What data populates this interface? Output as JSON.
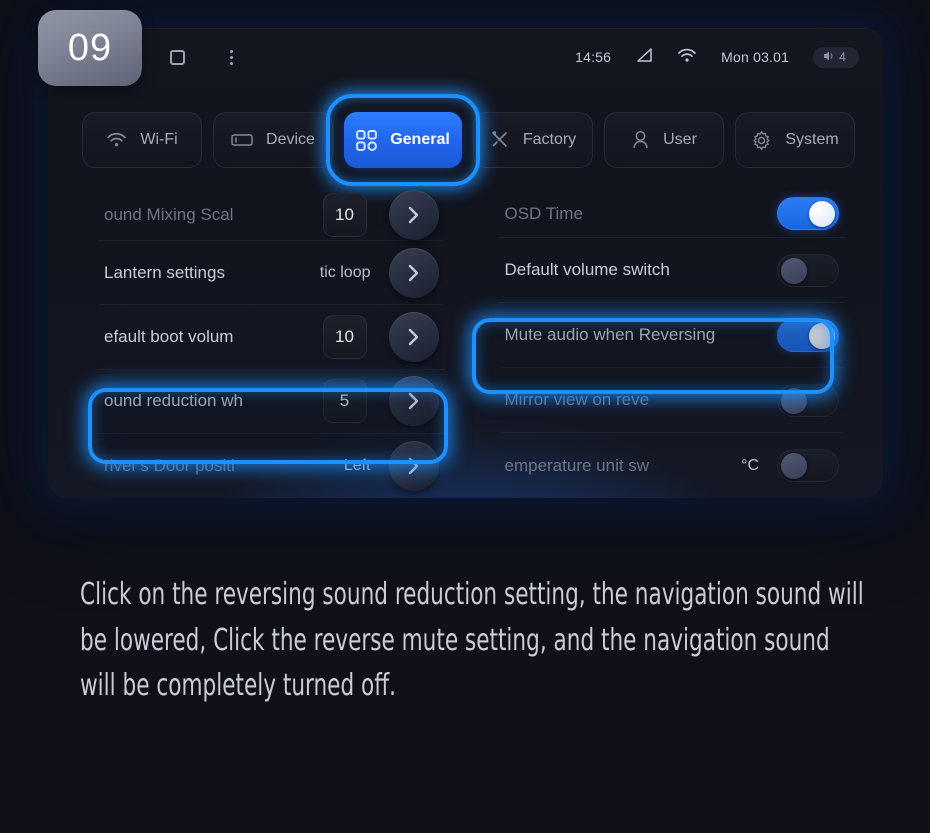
{
  "badge": {
    "number": "09"
  },
  "statusbar": {
    "nav": [
      {
        "name": "home-circle",
        "icon": "circle-icon"
      },
      {
        "name": "recents-square",
        "icon": "square-icon"
      },
      {
        "name": "overflow-menu",
        "icon": "three-dots-icon"
      }
    ],
    "time": "14:56",
    "signal_icon": "signal-triangle-icon",
    "wifi_icon": "wifi-icon",
    "date": "Mon 03.01",
    "volume_icon": "volume-icon",
    "volume_level": "4"
  },
  "tabs": [
    {
      "label": "Wi-Fi",
      "icon": "wifi-icon",
      "active": false
    },
    {
      "label": "Device",
      "icon": "device-icon",
      "active": false
    },
    {
      "label": "General",
      "icon": "grid-icon",
      "active": true
    },
    {
      "label": "Factory",
      "icon": "tools-icon",
      "active": false
    },
    {
      "label": "User",
      "icon": "person-icon",
      "active": false
    },
    {
      "label": "System",
      "icon": "gear-icon",
      "active": false
    }
  ],
  "settings": {
    "left_column": [
      {
        "label": "ound Mixing Scal",
        "value": "10",
        "control": "chevron",
        "clipped": true,
        "highlight": false
      },
      {
        "label": "Lantern settings",
        "value": "tic loop",
        "control": "chevron",
        "clipped": false,
        "highlight": false
      },
      {
        "label": "efault boot volum",
        "value": "10",
        "control": "chevron",
        "clipped": false,
        "highlight": false
      },
      {
        "label": "ound reduction wh",
        "value": "5",
        "control": "chevron",
        "clipped": false,
        "highlight": true
      },
      {
        "label": "river's Door positi",
        "value": "Left",
        "control": "chevron",
        "clipped": false,
        "highlight": false
      }
    ],
    "right_column": [
      {
        "label": "OSD Time",
        "value": "",
        "control": "toggle",
        "toggle_on": true,
        "clipped": true,
        "highlight": false
      },
      {
        "label": "Default volume switch",
        "value": "",
        "control": "toggle",
        "toggle_on": false,
        "clipped": false,
        "highlight": false
      },
      {
        "label": "Mute audio when Reversing",
        "value": "",
        "control": "toggle",
        "toggle_on": true,
        "clipped": false,
        "highlight": true
      },
      {
        "label": "Mirror view on reve",
        "value": "",
        "control": "toggle",
        "toggle_on": false,
        "clipped": false,
        "highlight": false
      },
      {
        "label": "emperature unit sw",
        "value": "°C",
        "control": "toggle",
        "toggle_on": false,
        "clipped": false,
        "highlight": false
      }
    ]
  },
  "caption": "Click on the reversing sound reduction setting, the navigation sound will be lowered, Click the reverse mute setting, and the navigation sound will be completely turned off.",
  "colors": {
    "background": "#0f1018",
    "accent_blue": "#1e90ff",
    "tab_active": "#2f7dff",
    "toggle_on": "#1866e0",
    "text_primary": "#c8ccd8",
    "text_muted": "#6e7488"
  }
}
